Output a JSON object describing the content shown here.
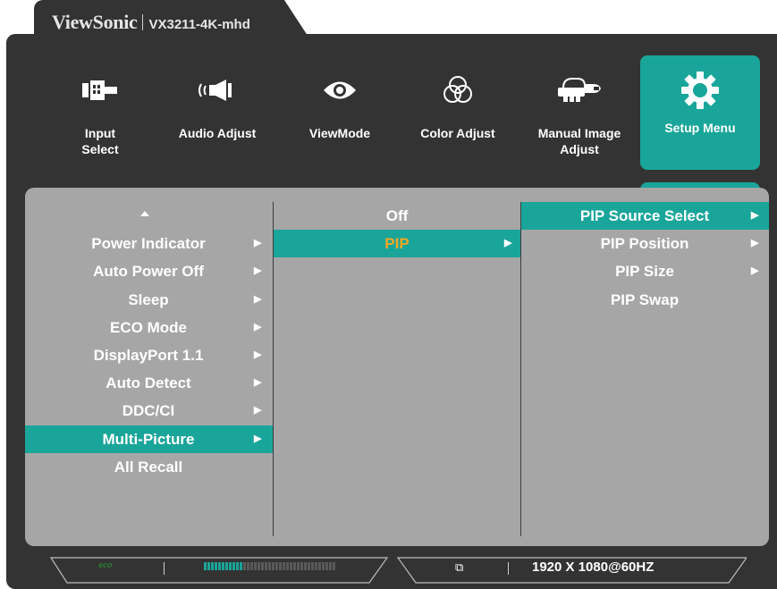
{
  "header": {
    "brand": "ViewSonic",
    "model": "VX3211-4K-mhd"
  },
  "top_menu": [
    {
      "label": "Input\nSelect",
      "icon": "input-select-icon"
    },
    {
      "label": "Audio Adjust",
      "icon": "speaker-icon"
    },
    {
      "label": "ViewMode",
      "icon": "eye-icon"
    },
    {
      "label": "Color Adjust",
      "icon": "color-circles-icon"
    },
    {
      "label": "Manual Image\nAdjust",
      "icon": "hand-icon"
    },
    {
      "label": "Setup Menu",
      "icon": "gear-icon",
      "active": true
    }
  ],
  "left_menu": [
    {
      "label": "Power Indicator"
    },
    {
      "label": "Auto Power Off"
    },
    {
      "label": "Sleep"
    },
    {
      "label": "ECO Mode"
    },
    {
      "label": "DisplayPort 1.1"
    },
    {
      "label": "Auto Detect"
    },
    {
      "label": "DDC/CI"
    },
    {
      "label": "Multi-Picture",
      "selected": true
    },
    {
      "label": "All Recall"
    }
  ],
  "mid_menu": [
    {
      "label": "Off"
    },
    {
      "label": "PIP",
      "selected": true
    }
  ],
  "right_menu": [
    {
      "label": "PIP Source Select",
      "selected": true
    },
    {
      "label": "PIP Position"
    },
    {
      "label": "PIP Size"
    },
    {
      "label": "PIP Swap"
    }
  ],
  "status_bar": {
    "eco_label": "eco",
    "resolution": "1920 X 1080@60HZ",
    "energy_level": 0.3
  },
  "colors": {
    "accent": "#1aa59a",
    "frame": "#333333",
    "panel": "#a6a6a7",
    "highlight_text": "#f5a623"
  }
}
